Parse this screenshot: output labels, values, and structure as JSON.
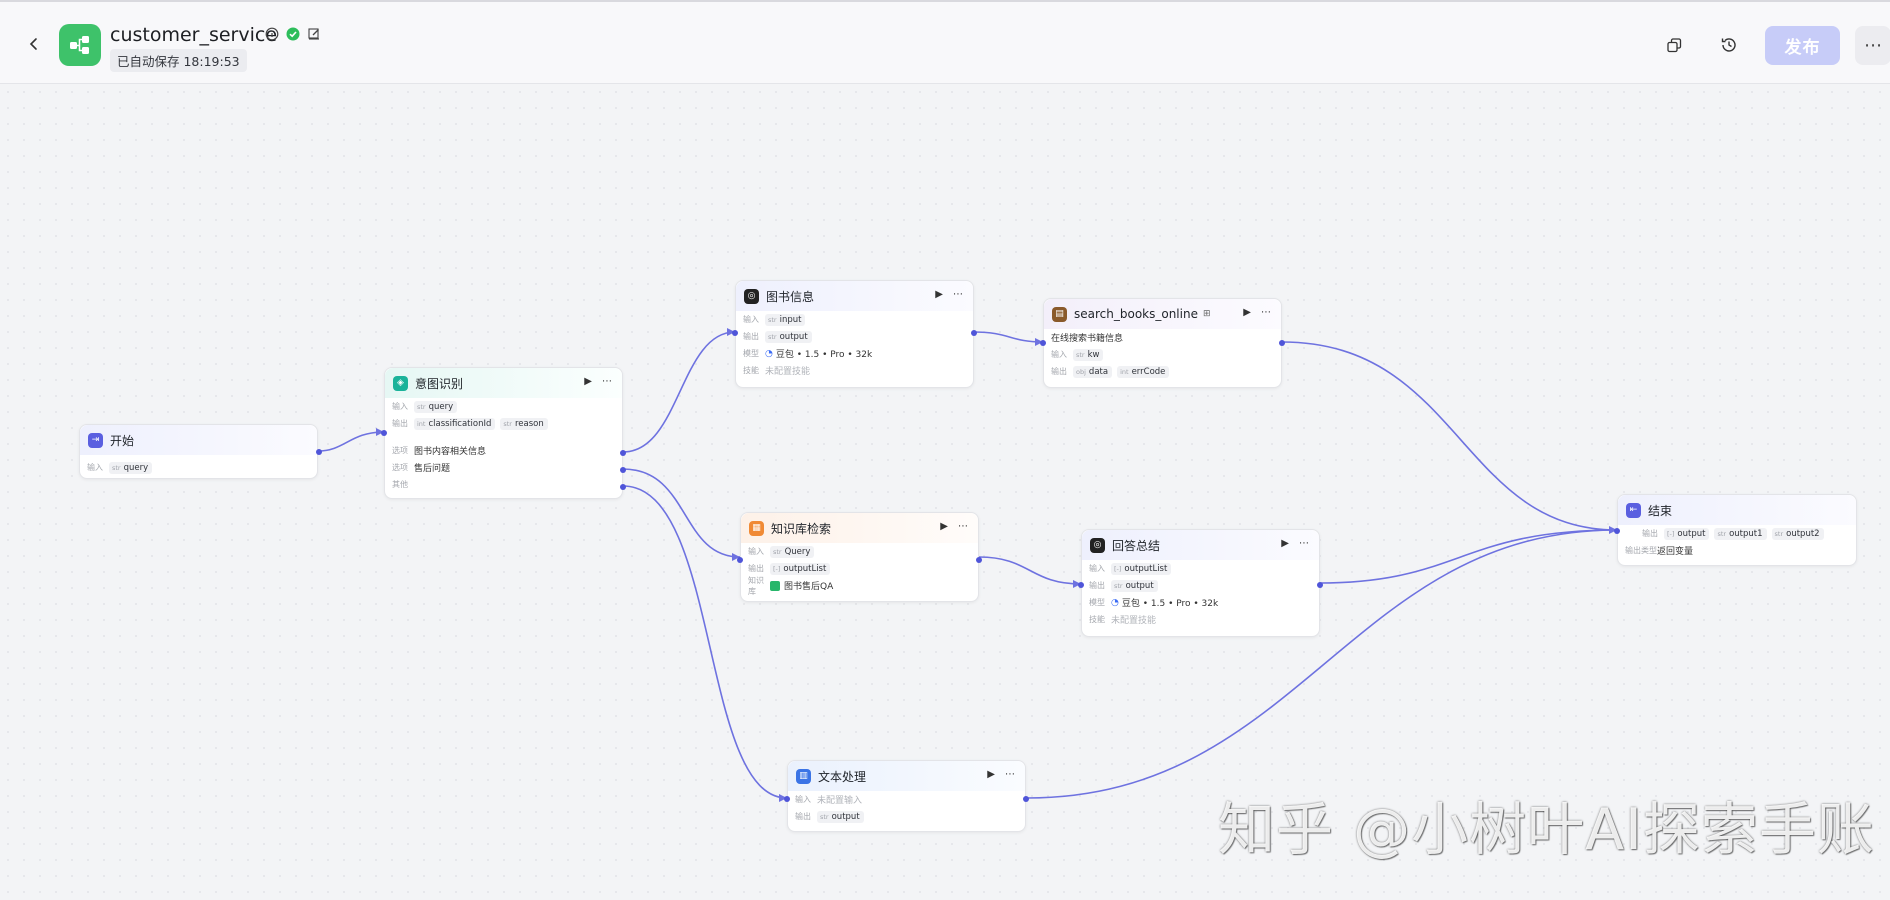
{
  "header": {
    "app_title": "customer_service",
    "autosave_text": "已自动保存 18:19:53",
    "publish_label": "发布",
    "more_label": "⋯"
  },
  "node_labels": {
    "input": "输入",
    "output": "输出",
    "model": "模型",
    "skill": "技能",
    "option": "选项",
    "other": "其他",
    "knowledge": "知识库",
    "output_type": "输出类型"
  },
  "nodes": {
    "start": {
      "title": "开始",
      "inputs": [
        {
          "type": "str",
          "name": "query"
        }
      ]
    },
    "intent": {
      "title": "意图识别",
      "inputs": [
        {
          "type": "str",
          "name": "query"
        }
      ],
      "outputs": [
        {
          "type": "int",
          "name": "classificationId"
        },
        {
          "type": "str",
          "name": "reason"
        }
      ],
      "options": [
        "图书内容相关信息",
        "售后问题"
      ]
    },
    "book_info": {
      "title": "图书信息",
      "inputs": [
        {
          "type": "str",
          "name": "input"
        }
      ],
      "outputs": [
        {
          "type": "str",
          "name": "output"
        }
      ],
      "model": "豆包 • 1.5 • Pro • 32k",
      "skill": "未配置技能"
    },
    "search_books": {
      "title": "search_books_online",
      "subtitle": "在线搜索书籍信息",
      "inputs": [
        {
          "type": "str",
          "name": "kw"
        }
      ],
      "outputs": [
        {
          "type": "obj",
          "name": "data"
        },
        {
          "type": "int",
          "name": "errCode"
        }
      ]
    },
    "kb_search": {
      "title": "知识库检索",
      "inputs": [
        {
          "type": "str",
          "name": "Query"
        }
      ],
      "outputs": [
        {
          "type": "[-]",
          "name": "outputList"
        }
      ],
      "knowledge": "图书售后QA"
    },
    "answer_summary": {
      "title": "回答总结",
      "inputs": [
        {
          "type": "[-]",
          "name": "outputList"
        }
      ],
      "outputs": [
        {
          "type": "str",
          "name": "output"
        }
      ],
      "model": "豆包 • 1.5 • Pro • 32k",
      "skill": "未配置技能"
    },
    "text_proc": {
      "title": "文本处理",
      "input_text": "未配置输入",
      "outputs": [
        {
          "type": "str",
          "name": "output"
        }
      ]
    },
    "end": {
      "title": "结束",
      "outputs": [
        {
          "type": "[-]",
          "name": "output"
        },
        {
          "type": "str",
          "name": "output1"
        },
        {
          "type": "str",
          "name": "output2"
        }
      ],
      "output_type": "返回变量"
    }
  },
  "watermark": "知乎 @小树叶AI探索手账",
  "colors": {
    "accent": "#4f55d9",
    "app_icon": "#3ec26a",
    "publish_bg": "#c7ccf8",
    "edge": "#6e72e0"
  }
}
